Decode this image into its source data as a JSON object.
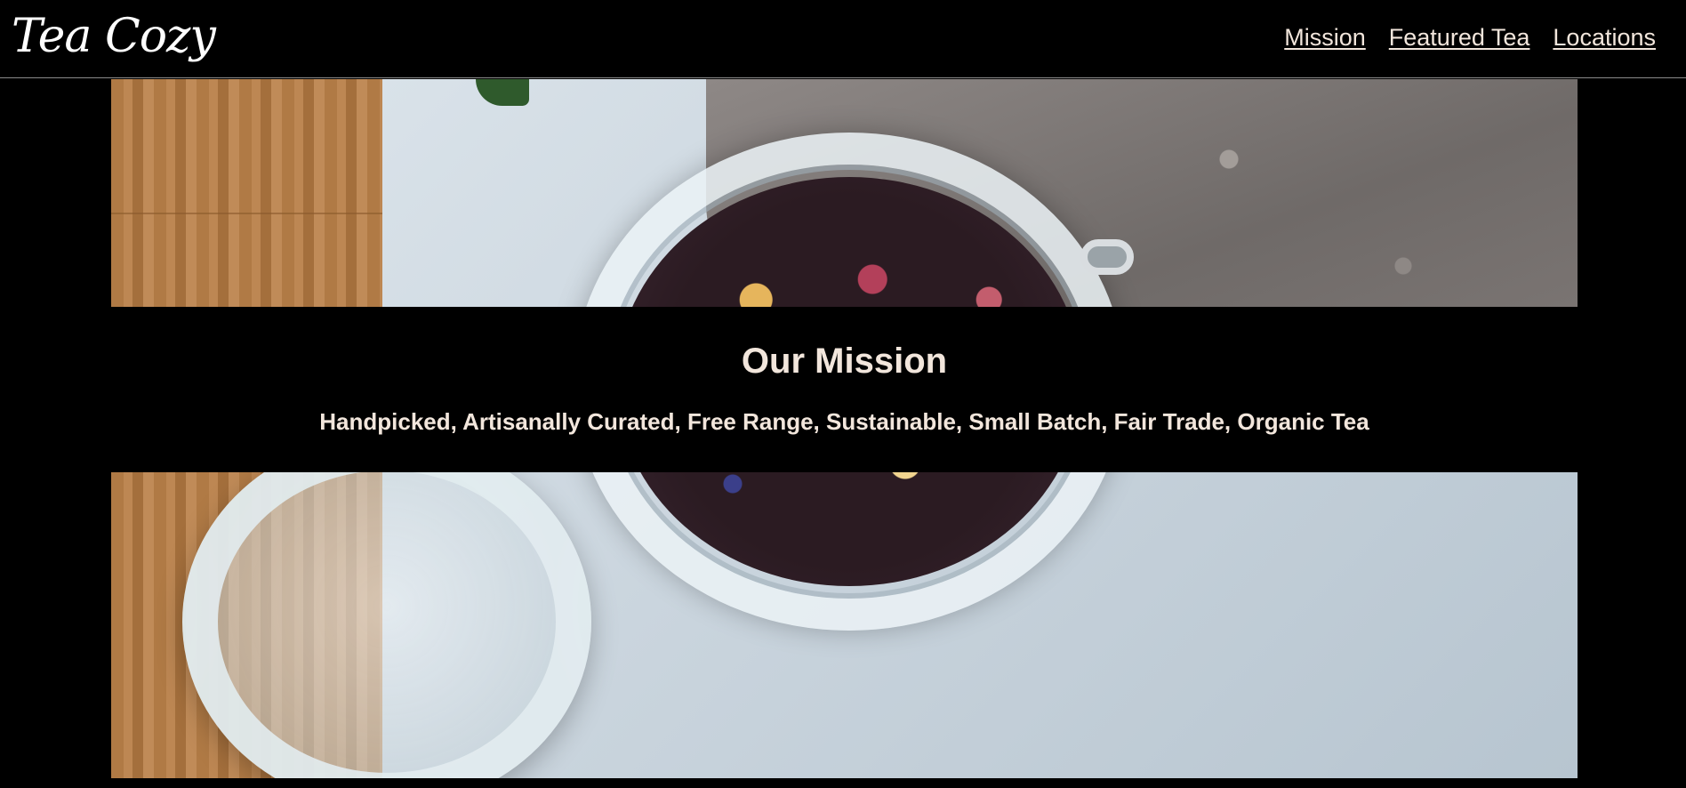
{
  "header": {
    "logo": "Tea Cozy",
    "nav": [
      {
        "label": "Mission"
      },
      {
        "label": "Featured Tea"
      },
      {
        "label": "Locations"
      }
    ]
  },
  "mission": {
    "title": "Our Mission",
    "text": "Handpicked, Artisanally Curated, Free Range, Sustainable, Small Batch, Fair Trade, Organic Tea"
  },
  "colors": {
    "background": "#000000",
    "text": "#f2e6dc",
    "logo": "#ffffff"
  }
}
